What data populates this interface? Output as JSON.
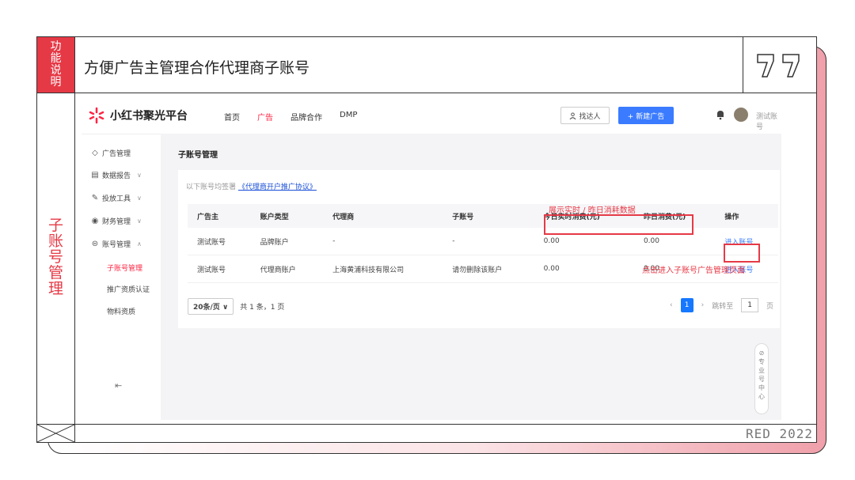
{
  "frame": {
    "tag_chars": [
      "功",
      "能",
      "说",
      "明"
    ],
    "header_title": "方便广告主管理合作代理商子账号",
    "side_title_chars": [
      "子",
      "账",
      "号",
      "管",
      "理"
    ],
    "brand": "RED 2022",
    "accent_color": "#e63946"
  },
  "app": {
    "logo_text": "小红书聚光平台",
    "nav": [
      "首页",
      "广告",
      "品牌合作",
      "DMP"
    ],
    "nav_active": "广告",
    "find_button": "找达人",
    "new_button": "+ 新建广告",
    "account_name": "测试账号",
    "sidebar": {
      "items": [
        {
          "icon": "tag-icon",
          "label": "广告管理",
          "arrow": ""
        },
        {
          "icon": "report-icon",
          "label": "数据报告",
          "arrow": "∨"
        },
        {
          "icon": "tools-icon",
          "label": "投放工具",
          "arrow": "∨"
        },
        {
          "icon": "finance-icon",
          "label": "财务管理",
          "arrow": "∨"
        },
        {
          "icon": "account-icon",
          "label": "账号管理",
          "arrow": "∧"
        }
      ],
      "subitems": [
        "子账号管理",
        "推广资质认证",
        "物料资质"
      ],
      "active_subitem": "子账号管理"
    },
    "page_title": "子账号管理",
    "notice_prefix": "以下账号均签署",
    "notice_link": "《代理商开户推广协议》",
    "table": {
      "headers": [
        "广告主",
        "账户类型",
        "代理商",
        "子账号",
        "今日实时消费(元)",
        "昨日消费(元)",
        "操作"
      ],
      "rows": [
        [
          "测试账号",
          "品牌账户",
          "-",
          "-",
          "0.00",
          "0.00",
          "进入账号"
        ],
        [
          "测试账号",
          "代理商账户",
          "上海黄浦科技有限公司",
          "请勿删除该账户",
          "0.00",
          "0.00",
          "进入账号"
        ]
      ]
    },
    "pager": {
      "page_size": "20条/页",
      "total": "共 1 条，1 页",
      "current_page": "1",
      "goto_label": "跳转至",
      "goto_value": "1",
      "goto_suffix": "页"
    }
  },
  "annotations": {
    "consumption_note": "展示实时 / 昨日消耗数据",
    "enter_note": "点击进入子账号广告管理页面"
  },
  "right_tab_chars": [
    "专",
    "业",
    "号",
    "中",
    "心"
  ]
}
